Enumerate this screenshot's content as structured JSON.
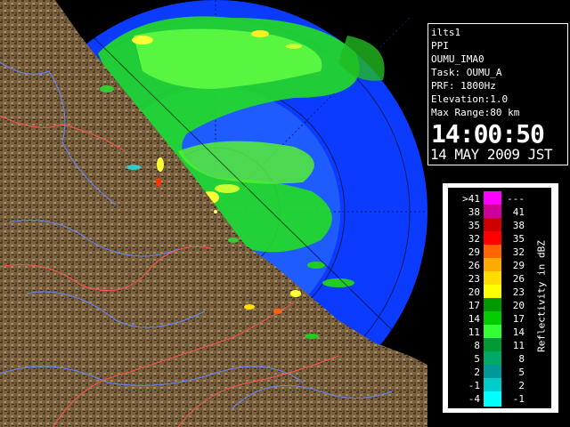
{
  "info": {
    "lines": [
      "ilts1",
      "PPI",
      "OUMU_IMA0",
      "Task: OUMU_A",
      "PRF: 1800Hz",
      "Elevation:1.0",
      "Max Range:80 km"
    ],
    "time": "14:00:50",
    "date": "14 MAY 2009 JST"
  },
  "legend": {
    "title": "Reflectivity in dBZ",
    "rows": [
      {
        "lo": ">41",
        "hi": "---",
        "color": "#ff00ff"
      },
      {
        "lo": "38",
        "hi": "41",
        "color": "#cc0099"
      },
      {
        "lo": "35",
        "hi": "38",
        "color": "#cc0000"
      },
      {
        "lo": "32",
        "hi": "35",
        "color": "#ff0000"
      },
      {
        "lo": "29",
        "hi": "32",
        "color": "#ff6600"
      },
      {
        "lo": "26",
        "hi": "29",
        "color": "#ffaa00"
      },
      {
        "lo": "23",
        "hi": "26",
        "color": "#ffdd00"
      },
      {
        "lo": "20",
        "hi": "23",
        "color": "#ffff00"
      },
      {
        "lo": "17",
        "hi": "20",
        "color": "#009900"
      },
      {
        "lo": "14",
        "hi": "17",
        "color": "#00cc00"
      },
      {
        "lo": "11",
        "hi": "14",
        "color": "#33ff33"
      },
      {
        "lo": "8",
        "hi": "11",
        "color": "#009933"
      },
      {
        "lo": "5",
        "hi": "8",
        "color": "#00aa66"
      },
      {
        "lo": "2",
        "hi": "5",
        "color": "#009999"
      },
      {
        "lo": "-1",
        "hi": "2",
        "color": "#00cccc"
      },
      {
        "lo": "-4",
        "hi": "-1",
        "color": "#00ffff"
      }
    ]
  },
  "colors": {
    "sea_far": "#0033ff",
    "sea_near": "#1a66ff",
    "land": "#7a6240",
    "land_dark": "#4a3a22",
    "echo_green": "#33ee33",
    "echo_yellow": "#ffff33",
    "river": "#6688ff",
    "border": "#ff6666"
  }
}
